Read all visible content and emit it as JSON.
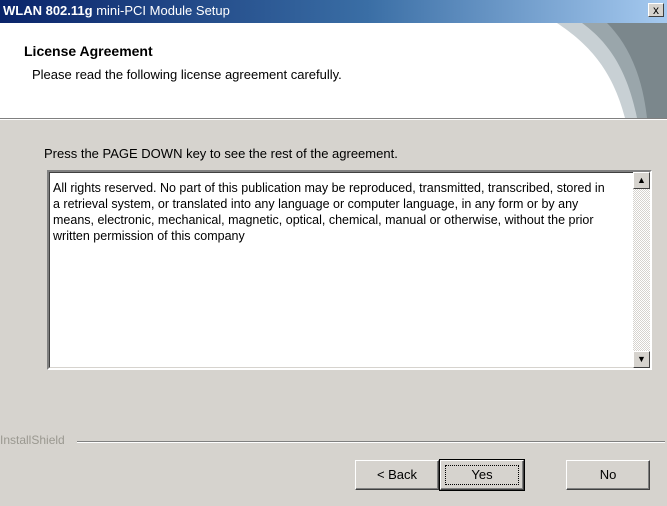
{
  "window": {
    "title_bold": "WLAN 802.11g",
    "title_rest": " mini-PCI Module Setup",
    "close_label": "x"
  },
  "header": {
    "title": "License Agreement",
    "subtitle": "Please read the following license agreement carefully."
  },
  "instruction": "Press the PAGE DOWN key to see the rest of the agreement.",
  "license": {
    "text": "All rights reserved. No part of this publication may be reproduced, transmitted, transcribed, stored in a retrieval system, or translated into any language or computer language, in any form or by any means, electronic, mechanical, magnetic, optical, chemical, manual or otherwise, without the prior written permission of this company"
  },
  "footer": {
    "brand": "InstallShield"
  },
  "buttons": {
    "back": "< Back",
    "yes": "Yes",
    "no": "No"
  },
  "colors": {
    "titlebar_start": "#0a246a",
    "titlebar_end": "#a6caf0",
    "dialog_bg": "#d6d3ce"
  },
  "icons": {
    "scroll_up": "up-arrow-icon",
    "scroll_down": "down-arrow-icon",
    "close": "close-icon"
  }
}
